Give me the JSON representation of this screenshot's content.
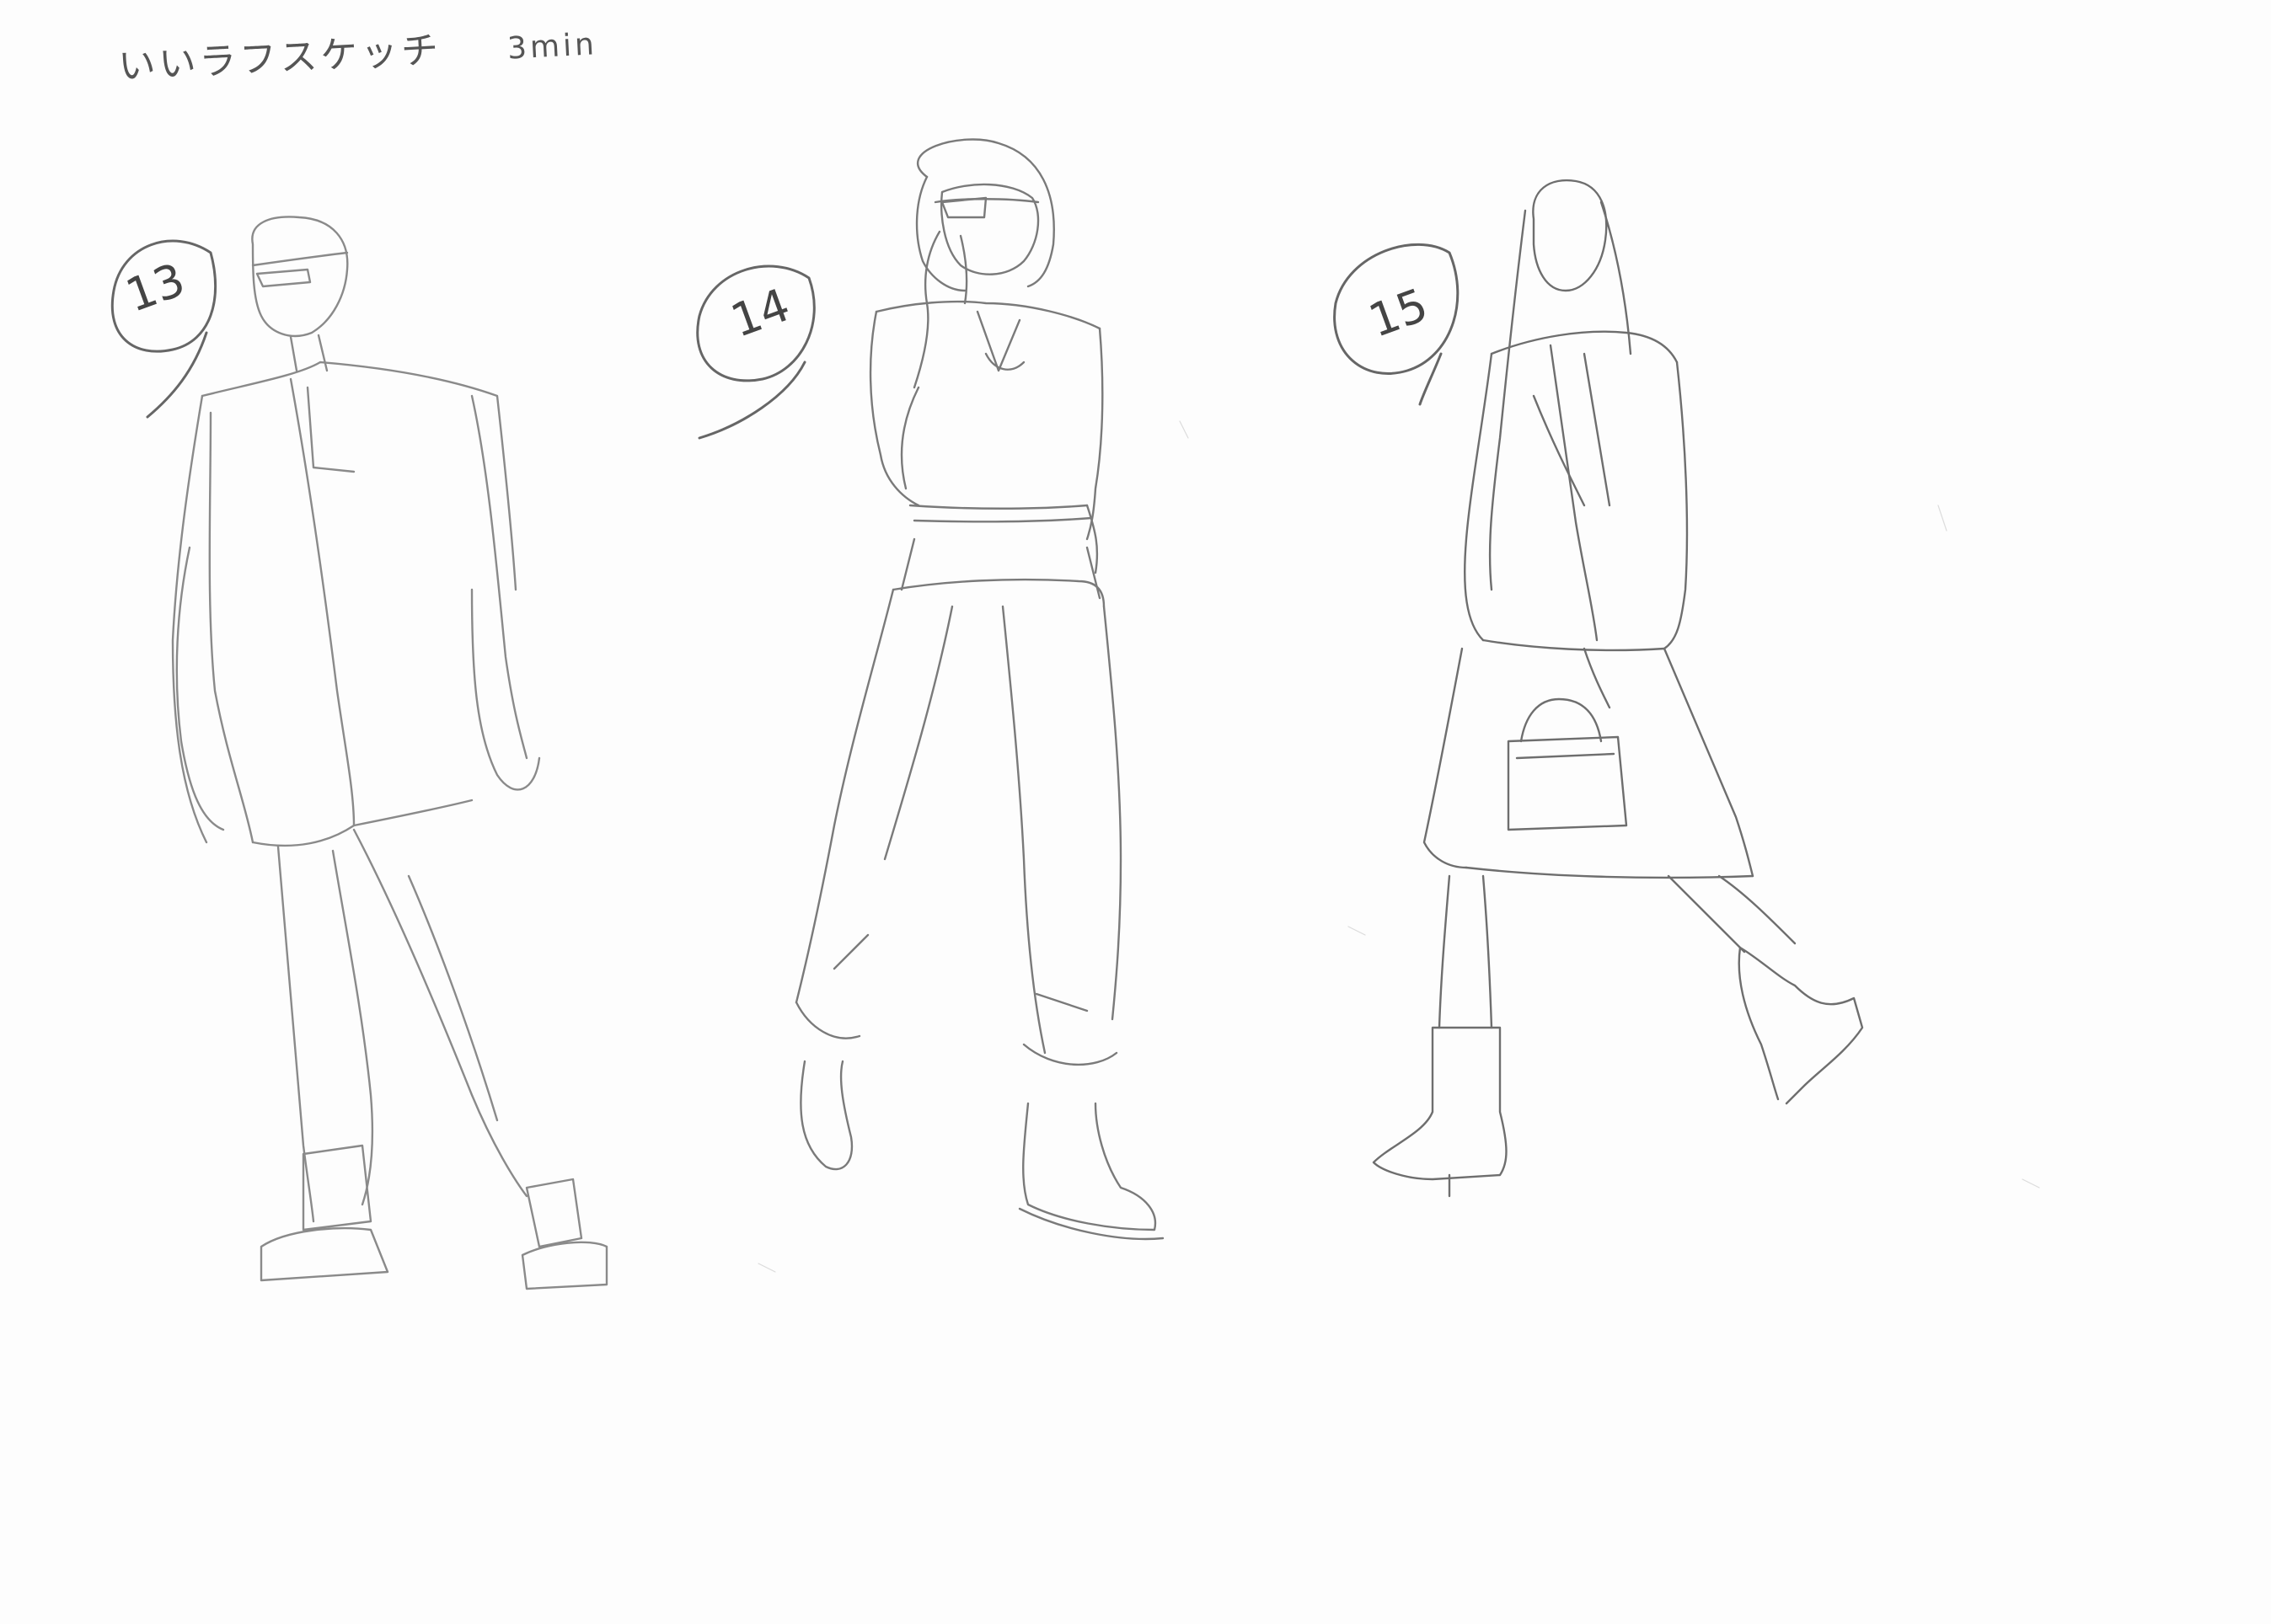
{
  "header": {
    "technique_text": "いいラフスケッチ",
    "duration_text": "3min"
  },
  "figures": [
    {
      "number": "13"
    },
    {
      "number": "14"
    },
    {
      "number": "15"
    }
  ],
  "colors": {
    "paper": "#fdfdfd",
    "pencil": "#6a6a6a",
    "pencil_light": "#a8a8a8"
  }
}
